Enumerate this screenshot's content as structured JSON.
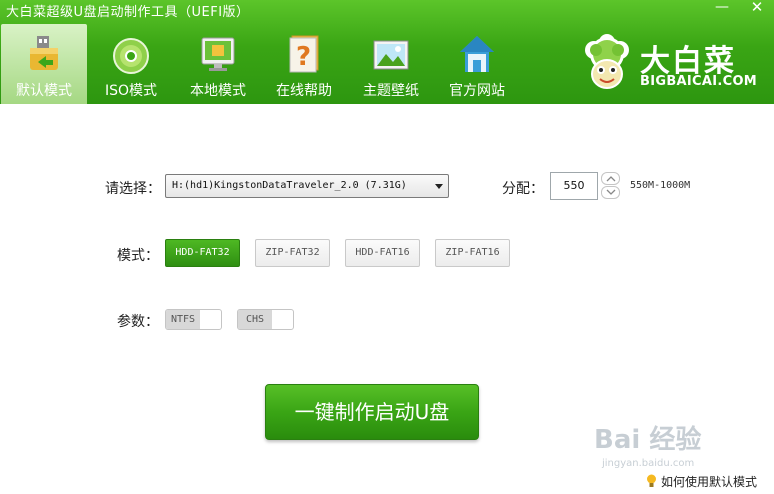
{
  "window": {
    "title": "大白菜超级U盘启动制作工具（UEFI版）",
    "minimize_glyph": "—",
    "close_glyph": "✕"
  },
  "nav": {
    "items": [
      {
        "label": "默认模式",
        "icon": "usb-drive-icon",
        "active": true
      },
      {
        "label": "ISO模式",
        "icon": "disc-icon",
        "active": false
      },
      {
        "label": "本地模式",
        "icon": "monitor-icon",
        "active": false
      },
      {
        "label": "在线帮助",
        "icon": "question-book-icon",
        "active": false
      },
      {
        "label": "主题壁纸",
        "icon": "landscape-picture-icon",
        "active": false
      },
      {
        "label": "官方网站",
        "icon": "home-icon",
        "active": false
      }
    ]
  },
  "logo": {
    "brand": "大白菜",
    "url": "BIGBAICAI.COM",
    "mascot_icon": "cabbage-mascot-icon"
  },
  "form": {
    "select_label": "请选择：",
    "select_value": "H:(hd1)KingstonDataTraveler_2.0 (7.31G)",
    "partition_label": "分配：",
    "partition_value": "550",
    "partition_range": "550M-1000M",
    "mode_label": "模式：",
    "modes": [
      {
        "label": "HDD-FAT32",
        "selected": true
      },
      {
        "label": "ZIP-FAT32",
        "selected": false
      },
      {
        "label": "HDD-FAT16",
        "selected": false
      },
      {
        "label": "ZIP-FAT16",
        "selected": false
      }
    ],
    "param_label": "参数：",
    "params": [
      {
        "label": "NTFS",
        "on": false
      },
      {
        "label": "CHS",
        "on": false
      }
    ]
  },
  "actions": {
    "make_button": "一键制作启动U盘",
    "help_link": "如何使用默认模式"
  },
  "watermark": {
    "text": "Bai 经验",
    "sub": "jingyan.baidu.com"
  },
  "colors": {
    "header_green": "#3aa514",
    "accent_green": "#2f8f12",
    "active_tab_bg": "#c3e6a7"
  }
}
